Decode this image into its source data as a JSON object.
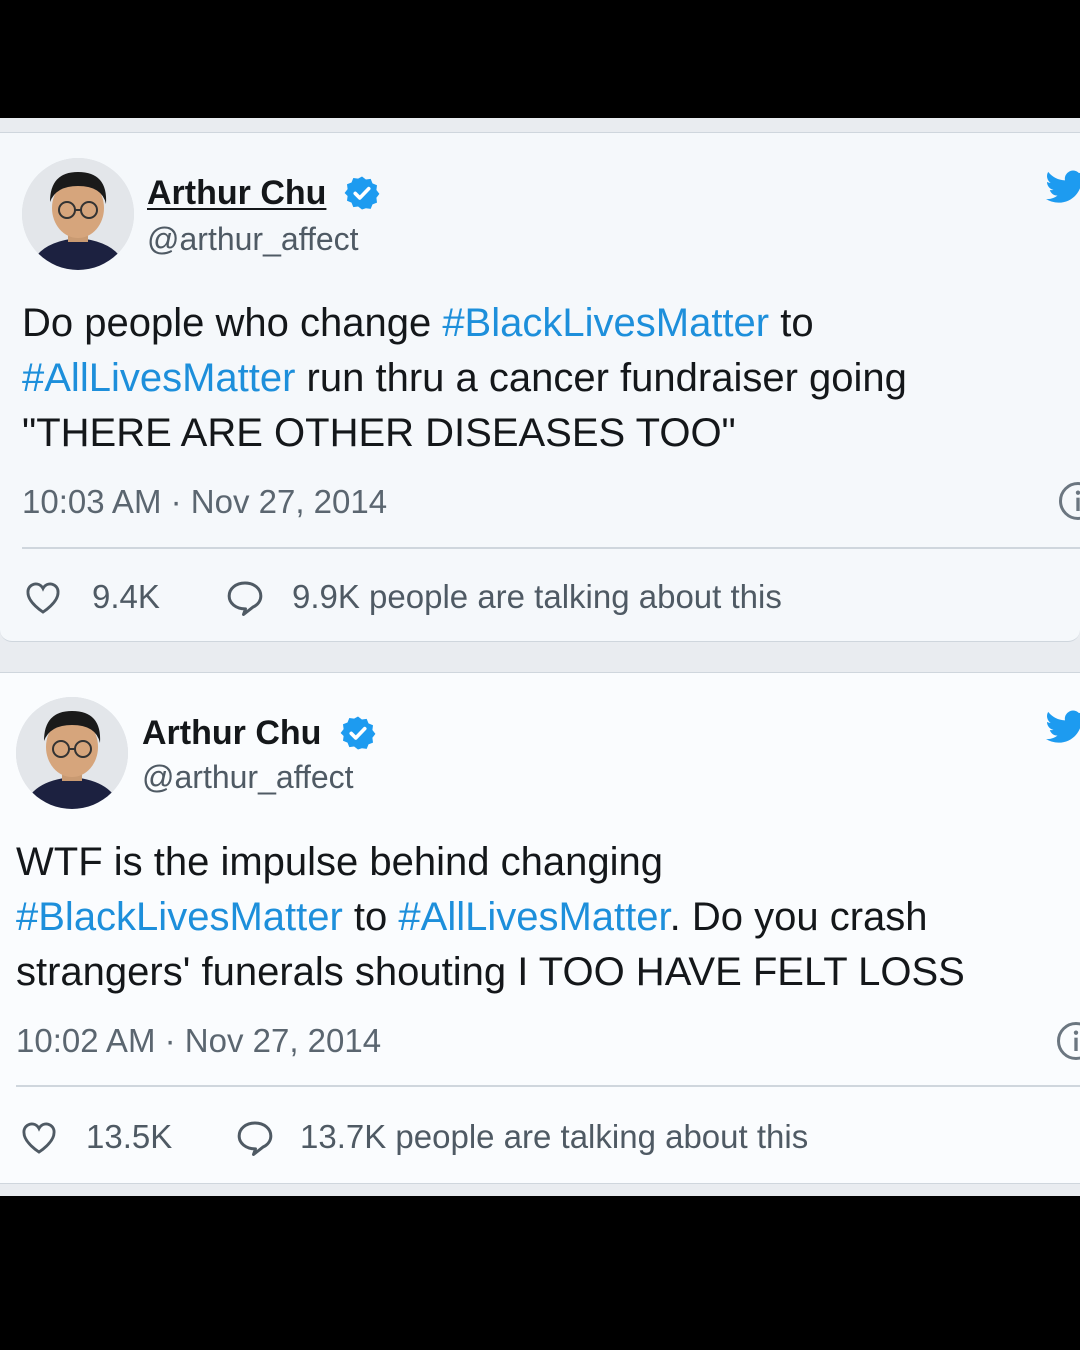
{
  "tweets": [
    {
      "name": "Arthur Chu",
      "handle": "@arthur_affect",
      "body": {
        "l1_a": "Do people who change ",
        "l1_tag": "#BlackLivesMatter",
        "l1_b": " to",
        "l2_tag": "#AllLivesMatter",
        "l2_b": " run thru a cancer fundraiser going",
        "l3": "\"THERE ARE OTHER DISEASES TOO\""
      },
      "timestamp": "10:03 AM · Nov 27, 2014",
      "likes": "9.4K",
      "talking": "9.9K people are talking about this"
    },
    {
      "name": "Arthur Chu",
      "handle": "@arthur_affect",
      "body": {
        "l1": "WTF is the impulse behind changing",
        "l2_tag1": "#BlackLivesMatter",
        "l2_mid": " to ",
        "l2_tag2": "#AllLivesMatter",
        "l2_b": ". Do you crash",
        "l3": "strangers' funerals shouting I TOO HAVE FELT LOSS"
      },
      "timestamp": "10:02 AM · Nov 27, 2014",
      "likes": "13.5K",
      "talking": "13.7K people are talking about this"
    }
  ],
  "icons": {
    "verified": "verified-badge-icon",
    "bird": "twitter-bird-icon",
    "info": "info-icon",
    "like": "heart-icon",
    "reply": "speech-bubble-icon"
  },
  "colors": {
    "hashtag": "#1d8fdb",
    "verified": "#1d9bf0",
    "bird": "#1d9bf0",
    "text": "#14171a",
    "muted": "#5b6670"
  }
}
